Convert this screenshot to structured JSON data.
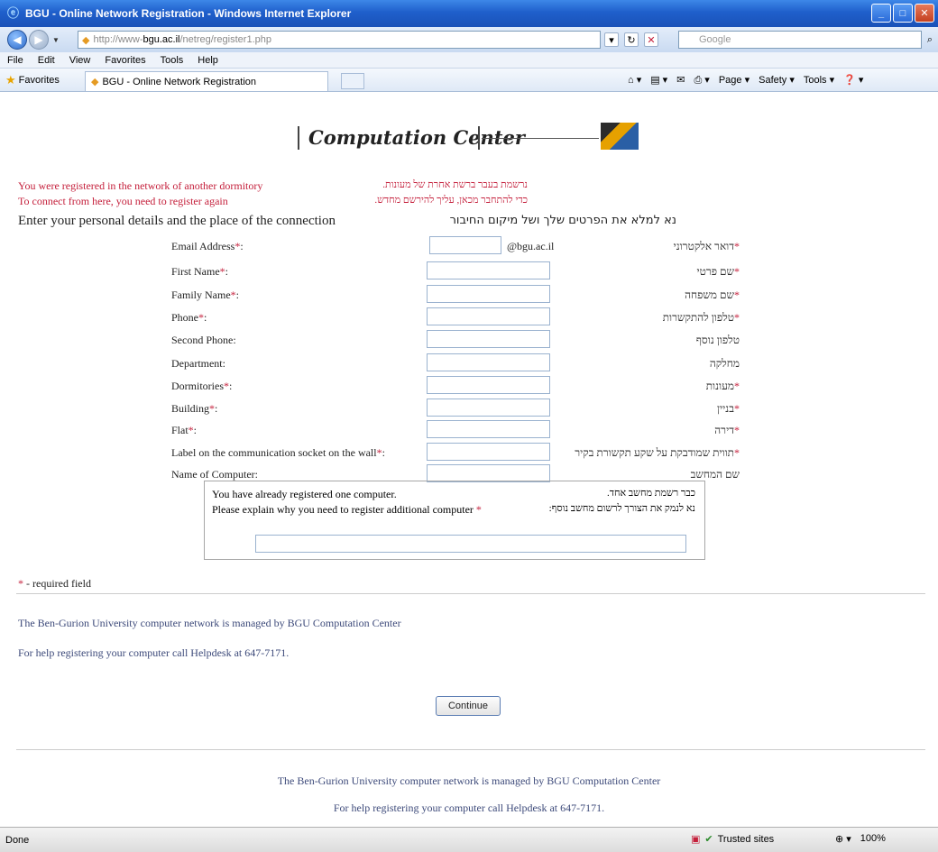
{
  "window": {
    "title": "BGU - Online Network Registration - Windows Internet Explorer",
    "buttons": [
      "_",
      "□",
      "✕"
    ]
  },
  "address_bar": {
    "url_prefix": "http://www-",
    "url_domain": "bgu.ac.il",
    "url_suffix": "/netreg/register1.php",
    "search_placeholder": "Google"
  },
  "menu": [
    "File",
    "Edit",
    "View",
    "Favorites",
    "Tools",
    "Help"
  ],
  "favorites_bar": {
    "favorites_label": "Favorites",
    "tab_title": "BGU - Online Network Registration",
    "commands": [
      "Page ▾",
      "Safety ▾",
      "Tools ▾"
    ]
  },
  "logo": {
    "text": "Computation Center"
  },
  "errors": {
    "en_line1": "You were registered in the network of another dormitory",
    "en_line2": "To connect from here, you need to register again",
    "he_line1": "נרשמת בעבר ברשת אחרת של מעונות.",
    "he_line2": "כדי להתחבר מכאן, עליך להירשם מחדש."
  },
  "instructions": {
    "en": "Enter your personal details and the place of the connection",
    "he": "נא למלא את הפרטים שלך ושל מיקום החיבור"
  },
  "form": {
    "email_suffix": "@bgu.ac.il",
    "fields": [
      {
        "label": "Email Address",
        "required": "*",
        "suffix_colon": ":",
        "he_label": "דואר אלקטרוני"
      },
      {
        "label": "First Name",
        "required": "*",
        "suffix_colon": ":",
        "he_label": "שם פרטי"
      },
      {
        "label": "Family Name",
        "required": "*",
        "suffix_colon": ":",
        "he_label": "שם משפחה"
      },
      {
        "label": "Phone",
        "required": "*",
        "suffix_colon": ":",
        "he_label": "טלפון להתקשרות"
      },
      {
        "label": "Second Phone",
        "required": "",
        "suffix_colon": ":",
        "he_label": "טלפון נוסף"
      },
      {
        "label": "Department",
        "required": "",
        "suffix_colon": ":",
        "he_label": "מחלקה"
      },
      {
        "label": "Dormitories",
        "required": "*",
        "suffix_colon": ":",
        "he_label": "מעונות"
      },
      {
        "label": "Building",
        "required": "*",
        "suffix_colon": ":",
        "he_label": "בניין"
      },
      {
        "label": "Flat",
        "required": "*",
        "suffix_colon": ":",
        "he_label": "דירה"
      },
      {
        "label": "Label on the communication socket on the wall",
        "required": "*",
        "suffix_colon": ":",
        "he_label": "תווית שמודבקת על שקע תקשורת בקיר"
      },
      {
        "label": "Name of Computer",
        "required": "",
        "suffix_colon": ":",
        "he_label": "שם המחשב"
      }
    ]
  },
  "notice": {
    "en_line1": "You have already registered one computer.",
    "en_line2": "Please explain why you need to register additional computer",
    "required": "*",
    "he_line1": "כבר רשמת מחשב אחד.",
    "he_line2": "נא לנמק את הצורך לרשום מחשב נוסף:"
  },
  "required_note": {
    "star": "*",
    "text": " - required field"
  },
  "footer_top": {
    "line1": "The Ben-Gurion University computer network is managed by BGU Computation Center",
    "line2": "For help registering your computer call Helpdesk at 647-7171."
  },
  "continue_label": "Continue",
  "footer_bottom": {
    "line1": "The Ben-Gurion University computer network is managed by BGU Computation Center",
    "line2": "For help registering your computer call Helpdesk at 647-7171."
  },
  "status_bar": {
    "status": "Done",
    "zone": "Trusted sites",
    "zoom": "100%"
  }
}
